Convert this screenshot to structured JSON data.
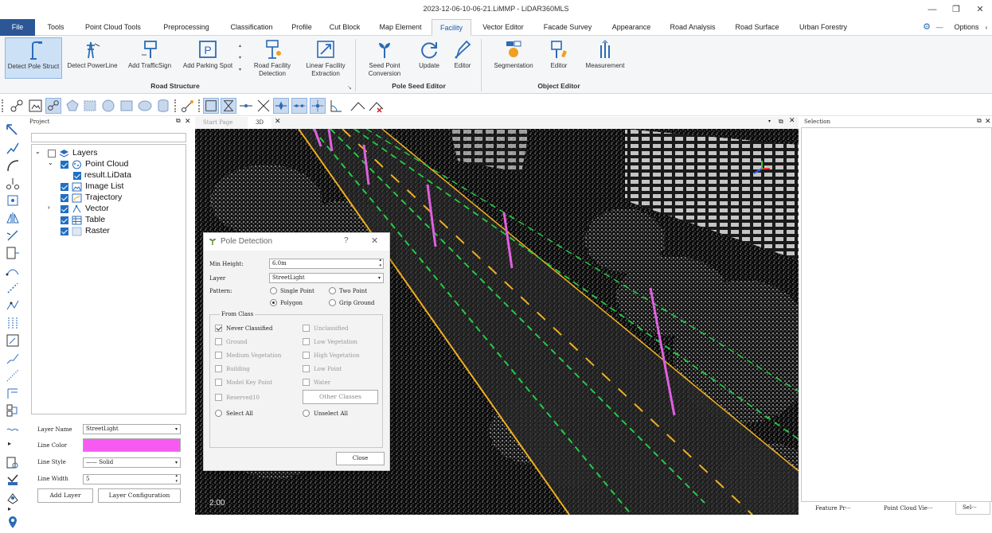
{
  "window": {
    "title": "2023-12-06-10-06-21.LiMMP - LiDAR360MLS"
  },
  "menu": {
    "tabs": [
      "File",
      "Tools",
      "Point Cloud Tools",
      "Preprocessing",
      "Classification",
      "Profile",
      "Cut Block",
      "Map Element",
      "Facility",
      "Vector Editor",
      "Facade Survey",
      "Appearance",
      "Road Analysis",
      "Road Surface",
      "Urban Forestry"
    ],
    "active": "Facility",
    "options_label": "Options"
  },
  "ribbon": {
    "road_structure": {
      "label": "Road Structure",
      "buttons": [
        "Detect Pole Struct",
        "Detect PowerLine",
        "Add TrafficSign",
        "Add Parking Spot",
        "Road Facility Detection",
        "Linear Facility Extraction"
      ]
    },
    "pole_seed_editor": {
      "label": "Pole Seed Editor",
      "buttons": [
        "Seed Point Conversion",
        "Update",
        "Editor"
      ]
    },
    "object_editor": {
      "label": "Object Editor",
      "buttons": [
        "Segmentation",
        "Editor",
        "Measurement"
      ]
    }
  },
  "project_panel": {
    "title": "Project",
    "tree": [
      {
        "label": "Layers"
      },
      {
        "label": "Point Cloud"
      },
      {
        "label": "result.LiData"
      },
      {
        "label": "Image List"
      },
      {
        "label": "Trajectory"
      },
      {
        "label": "Vector"
      },
      {
        "label": "Table"
      },
      {
        "label": "Raster"
      }
    ],
    "layer_props": {
      "layer_name_label": "Layer Name",
      "layer_name_value": "StreetLight",
      "line_color_label": "Line Color",
      "line_color": "#f75af2",
      "line_style_label": "Line Style",
      "line_style_value": "Solid",
      "line_width_label": "Line Width",
      "line_width_value": "5"
    },
    "add_layer_label": "Add Layer",
    "layer_config_label": "Layer Configuration"
  },
  "viewport": {
    "tabs": [
      "Start Page",
      "3D"
    ],
    "scale_text": "2.00",
    "pole_color": "#e060e0",
    "lane_green": "#22cc44",
    "lane_yellow": "#f0b020"
  },
  "selection_panel": {
    "title": "Selection",
    "bottom_tabs": [
      "Feature Pr···",
      "Point Cloud Vie···",
      "Sel···"
    ]
  },
  "pole_dialog": {
    "title": "Pole Detection",
    "help_label": "?",
    "min_height_label": "Min Height:",
    "min_height_value": "6.0m",
    "layer_label": "Layer",
    "layer_value": "StreetLight",
    "pattern_label": "Pattern:",
    "pattern_options": [
      "Single Point",
      "Two Point",
      "Polygon",
      "Grip Ground"
    ],
    "from_class_label": "From Class",
    "classes_left": [
      "Never Classified",
      "Ground",
      "Medium Vegetation",
      "Building",
      "Model Key Point",
      "Reserved10"
    ],
    "classes_right": [
      "Unclassified",
      "Low Vegetation",
      "High Vegetation",
      "Low Point",
      "Water"
    ],
    "other_classes_label": "Other Classes",
    "select_all_label": "Select All",
    "unselect_all_label": "Unselect All",
    "close_label": "Close"
  }
}
